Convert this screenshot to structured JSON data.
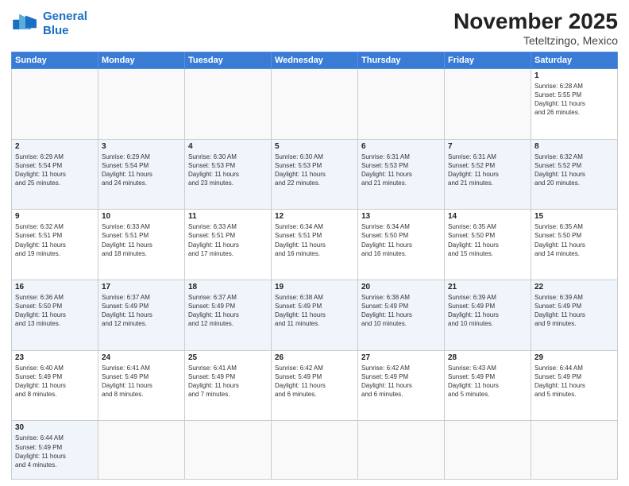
{
  "logo": {
    "line1": "General",
    "line2": "Blue"
  },
  "header": {
    "month": "November 2025",
    "location": "Teteltzingo, Mexico"
  },
  "days_of_week": [
    "Sunday",
    "Monday",
    "Tuesday",
    "Wednesday",
    "Thursday",
    "Friday",
    "Saturday"
  ],
  "weeks": [
    [
      {
        "day": "",
        "info": ""
      },
      {
        "day": "",
        "info": ""
      },
      {
        "day": "",
        "info": ""
      },
      {
        "day": "",
        "info": ""
      },
      {
        "day": "",
        "info": ""
      },
      {
        "day": "",
        "info": ""
      },
      {
        "day": "1",
        "info": "Sunrise: 6:28 AM\nSunset: 5:55 PM\nDaylight: 11 hours\nand 26 minutes."
      }
    ],
    [
      {
        "day": "2",
        "info": "Sunrise: 6:29 AM\nSunset: 5:54 PM\nDaylight: 11 hours\nand 25 minutes."
      },
      {
        "day": "3",
        "info": "Sunrise: 6:29 AM\nSunset: 5:54 PM\nDaylight: 11 hours\nand 24 minutes."
      },
      {
        "day": "4",
        "info": "Sunrise: 6:30 AM\nSunset: 5:53 PM\nDaylight: 11 hours\nand 23 minutes."
      },
      {
        "day": "5",
        "info": "Sunrise: 6:30 AM\nSunset: 5:53 PM\nDaylight: 11 hours\nand 22 minutes."
      },
      {
        "day": "6",
        "info": "Sunrise: 6:31 AM\nSunset: 5:53 PM\nDaylight: 11 hours\nand 21 minutes."
      },
      {
        "day": "7",
        "info": "Sunrise: 6:31 AM\nSunset: 5:52 PM\nDaylight: 11 hours\nand 21 minutes."
      },
      {
        "day": "8",
        "info": "Sunrise: 6:32 AM\nSunset: 5:52 PM\nDaylight: 11 hours\nand 20 minutes."
      }
    ],
    [
      {
        "day": "9",
        "info": "Sunrise: 6:32 AM\nSunset: 5:51 PM\nDaylight: 11 hours\nand 19 minutes."
      },
      {
        "day": "10",
        "info": "Sunrise: 6:33 AM\nSunset: 5:51 PM\nDaylight: 11 hours\nand 18 minutes."
      },
      {
        "day": "11",
        "info": "Sunrise: 6:33 AM\nSunset: 5:51 PM\nDaylight: 11 hours\nand 17 minutes."
      },
      {
        "day": "12",
        "info": "Sunrise: 6:34 AM\nSunset: 5:51 PM\nDaylight: 11 hours\nand 16 minutes."
      },
      {
        "day": "13",
        "info": "Sunrise: 6:34 AM\nSunset: 5:50 PM\nDaylight: 11 hours\nand 16 minutes."
      },
      {
        "day": "14",
        "info": "Sunrise: 6:35 AM\nSunset: 5:50 PM\nDaylight: 11 hours\nand 15 minutes."
      },
      {
        "day": "15",
        "info": "Sunrise: 6:35 AM\nSunset: 5:50 PM\nDaylight: 11 hours\nand 14 minutes."
      }
    ],
    [
      {
        "day": "16",
        "info": "Sunrise: 6:36 AM\nSunset: 5:50 PM\nDaylight: 11 hours\nand 13 minutes."
      },
      {
        "day": "17",
        "info": "Sunrise: 6:37 AM\nSunset: 5:49 PM\nDaylight: 11 hours\nand 12 minutes."
      },
      {
        "day": "18",
        "info": "Sunrise: 6:37 AM\nSunset: 5:49 PM\nDaylight: 11 hours\nand 12 minutes."
      },
      {
        "day": "19",
        "info": "Sunrise: 6:38 AM\nSunset: 5:49 PM\nDaylight: 11 hours\nand 11 minutes."
      },
      {
        "day": "20",
        "info": "Sunrise: 6:38 AM\nSunset: 5:49 PM\nDaylight: 11 hours\nand 10 minutes."
      },
      {
        "day": "21",
        "info": "Sunrise: 6:39 AM\nSunset: 5:49 PM\nDaylight: 11 hours\nand 10 minutes."
      },
      {
        "day": "22",
        "info": "Sunrise: 6:39 AM\nSunset: 5:49 PM\nDaylight: 11 hours\nand 9 minutes."
      }
    ],
    [
      {
        "day": "23",
        "info": "Sunrise: 6:40 AM\nSunset: 5:49 PM\nDaylight: 11 hours\nand 8 minutes."
      },
      {
        "day": "24",
        "info": "Sunrise: 6:41 AM\nSunset: 5:49 PM\nDaylight: 11 hours\nand 8 minutes."
      },
      {
        "day": "25",
        "info": "Sunrise: 6:41 AM\nSunset: 5:49 PM\nDaylight: 11 hours\nand 7 minutes."
      },
      {
        "day": "26",
        "info": "Sunrise: 6:42 AM\nSunset: 5:49 PM\nDaylight: 11 hours\nand 6 minutes."
      },
      {
        "day": "27",
        "info": "Sunrise: 6:42 AM\nSunset: 5:49 PM\nDaylight: 11 hours\nand 6 minutes."
      },
      {
        "day": "28",
        "info": "Sunrise: 6:43 AM\nSunset: 5:49 PM\nDaylight: 11 hours\nand 5 minutes."
      },
      {
        "day": "29",
        "info": "Sunrise: 6:44 AM\nSunset: 5:49 PM\nDaylight: 11 hours\nand 5 minutes."
      }
    ],
    [
      {
        "day": "30",
        "info": "Sunrise: 6:44 AM\nSunset: 5:49 PM\nDaylight: 11 hours\nand 4 minutes."
      },
      {
        "day": "",
        "info": ""
      },
      {
        "day": "",
        "info": ""
      },
      {
        "day": "",
        "info": ""
      },
      {
        "day": "",
        "info": ""
      },
      {
        "day": "",
        "info": ""
      },
      {
        "day": "",
        "info": ""
      }
    ]
  ]
}
